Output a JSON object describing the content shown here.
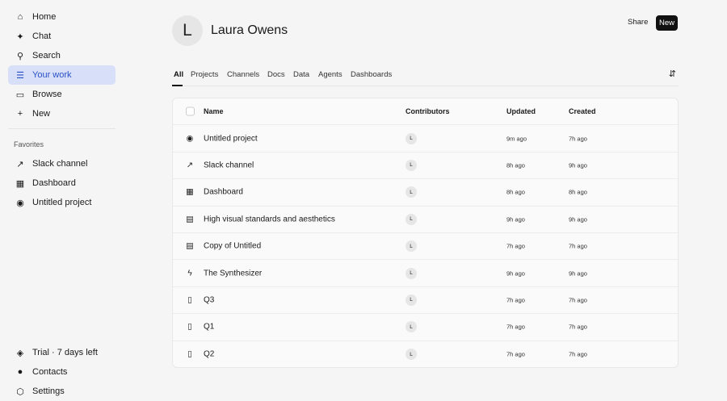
{
  "sidebar": {
    "nav": [
      {
        "label": "Home",
        "icon": "home-icon",
        "g": "⌂"
      },
      {
        "label": "Chat",
        "icon": "sparkle-icon",
        "g": "✦"
      },
      {
        "label": "Search",
        "icon": "search-icon",
        "g": "⚲"
      },
      {
        "label": "Your work",
        "icon": "stack-icon",
        "g": "☰"
      },
      {
        "label": "Browse",
        "icon": "folder-icon",
        "g": "▭"
      },
      {
        "label": "New",
        "icon": "plus-icon",
        "g": "+"
      }
    ],
    "favorites_label": "Favorites",
    "favorites": [
      {
        "label": "Slack channel",
        "icon": "channel-icon",
        "g": "↗"
      },
      {
        "label": "Dashboard",
        "icon": "dashboard-icon",
        "g": "▦"
      },
      {
        "label": "Untitled project",
        "icon": "compass-icon",
        "g": "◉"
      }
    ],
    "bottom": [
      {
        "label": "Trial · 7 days left",
        "icon": "diamond-icon",
        "g": "◈"
      },
      {
        "label": "Contacts",
        "icon": "contact-icon",
        "g": "●"
      },
      {
        "label": "Settings",
        "icon": "settings-icon",
        "g": "⬡"
      }
    ]
  },
  "header": {
    "avatar": "L",
    "name": "Laura Owens",
    "share": "Share",
    "new": "New"
  },
  "tabs": [
    "All",
    "Projects",
    "Channels",
    "Docs",
    "Data",
    "Agents",
    "Dashboards"
  ],
  "table": {
    "columns": {
      "name": "Name",
      "contributors": "Contributors",
      "updated": "Updated",
      "created": "Created"
    },
    "rows": [
      {
        "name": "Untitled project",
        "icon": "compass-icon",
        "g": "◉",
        "contrib": "L",
        "updated": "9m ago",
        "created": "7h ago"
      },
      {
        "name": "Slack channel",
        "icon": "channel-icon",
        "g": "↗",
        "contrib": "L",
        "updated": "8h ago",
        "created": "9h ago"
      },
      {
        "name": "Dashboard",
        "icon": "dashboard-icon",
        "g": "▦",
        "contrib": "L",
        "updated": "8h ago",
        "created": "8h ago"
      },
      {
        "name": "High visual standards and aesthetics",
        "icon": "doc-icon",
        "g": "▤",
        "contrib": "L",
        "updated": "9h ago",
        "created": "9h ago"
      },
      {
        "name": "Copy of Untitled",
        "icon": "doc-icon",
        "g": "▤",
        "contrib": "L",
        "updated": "7h ago",
        "created": "7h ago"
      },
      {
        "name": "The Synthesizer",
        "icon": "bolt-icon",
        "g": "ϟ",
        "contrib": "L",
        "updated": "9h ago",
        "created": "9h ago"
      },
      {
        "name": "Q3",
        "icon": "file-icon",
        "g": "▯",
        "contrib": "L",
        "updated": "7h ago",
        "created": "7h ago"
      },
      {
        "name": "Q1",
        "icon": "file-icon",
        "g": "▯",
        "contrib": "L",
        "updated": "7h ago",
        "created": "7h ago"
      },
      {
        "name": "Q2",
        "icon": "file-icon",
        "g": "▯",
        "contrib": "L",
        "updated": "7h ago",
        "created": "7h ago"
      }
    ]
  }
}
